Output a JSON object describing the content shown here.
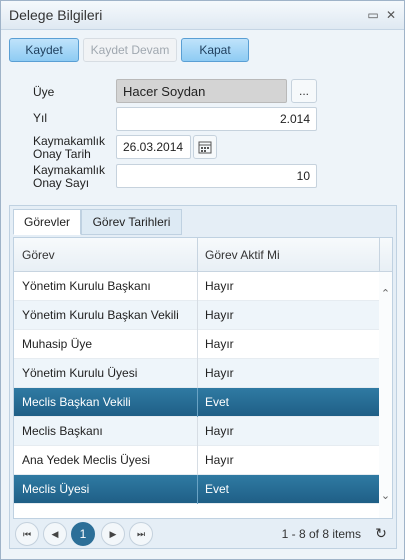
{
  "window": {
    "title": "Delege Bilgileri",
    "minimize_glyph": "▭",
    "close_glyph": "✕"
  },
  "toolbar": {
    "save_label": "Kaydet",
    "save_continue_label": "Kaydet Devam",
    "close_label": "Kapat"
  },
  "form": {
    "uye_label": "Üye",
    "uye_value": "Hacer Soydan",
    "uye_lookup_label": "...",
    "yil_label": "Yıl",
    "yil_value": "2.014",
    "onay_tarih_label_1": "Kaymakamlık",
    "onay_tarih_label_2": "Onay Tarih",
    "onay_tarih_value": "26.03.2014",
    "onay_sayi_label_1": "Kaymakamlık",
    "onay_sayi_label_2": "Onay Sayı",
    "onay_sayi_value": "10"
  },
  "tabs": [
    {
      "label": "Görevler",
      "active": true
    },
    {
      "label": "Görev Tarihleri",
      "active": false
    }
  ],
  "grid": {
    "columns": [
      "Görev",
      "Görev Aktif Mi"
    ],
    "rows": [
      {
        "gorev": "Yönetim Kurulu Başkanı",
        "aktif": "Hayır"
      },
      {
        "gorev": "Yönetim Kurulu Başkan Vekili",
        "aktif": "Hayır"
      },
      {
        "gorev": "Muhasip Üye",
        "aktif": "Hayır"
      },
      {
        "gorev": "Yönetim Kurulu Üyesi",
        "aktif": "Hayır"
      },
      {
        "gorev": "Meclis Başkan Vekili",
        "aktif": "Evet"
      },
      {
        "gorev": "Meclis Başkanı",
        "aktif": "Hayır"
      },
      {
        "gorev": "Ana Yedek Meclis Üyesi",
        "aktif": "Hayır"
      },
      {
        "gorev": "Meclis Üyesi",
        "aktif": "Evet"
      }
    ]
  },
  "pager": {
    "current_page": "1",
    "info": "1 - 8 of 8 items",
    "first_glyph": "⏮",
    "prev_glyph": "◀",
    "next_glyph": "▶",
    "last_glyph": "⏭",
    "refresh_glyph": "↻"
  },
  "colors": {
    "selected_row": "#2a6e96",
    "button_accent": "#8ecbf3"
  }
}
